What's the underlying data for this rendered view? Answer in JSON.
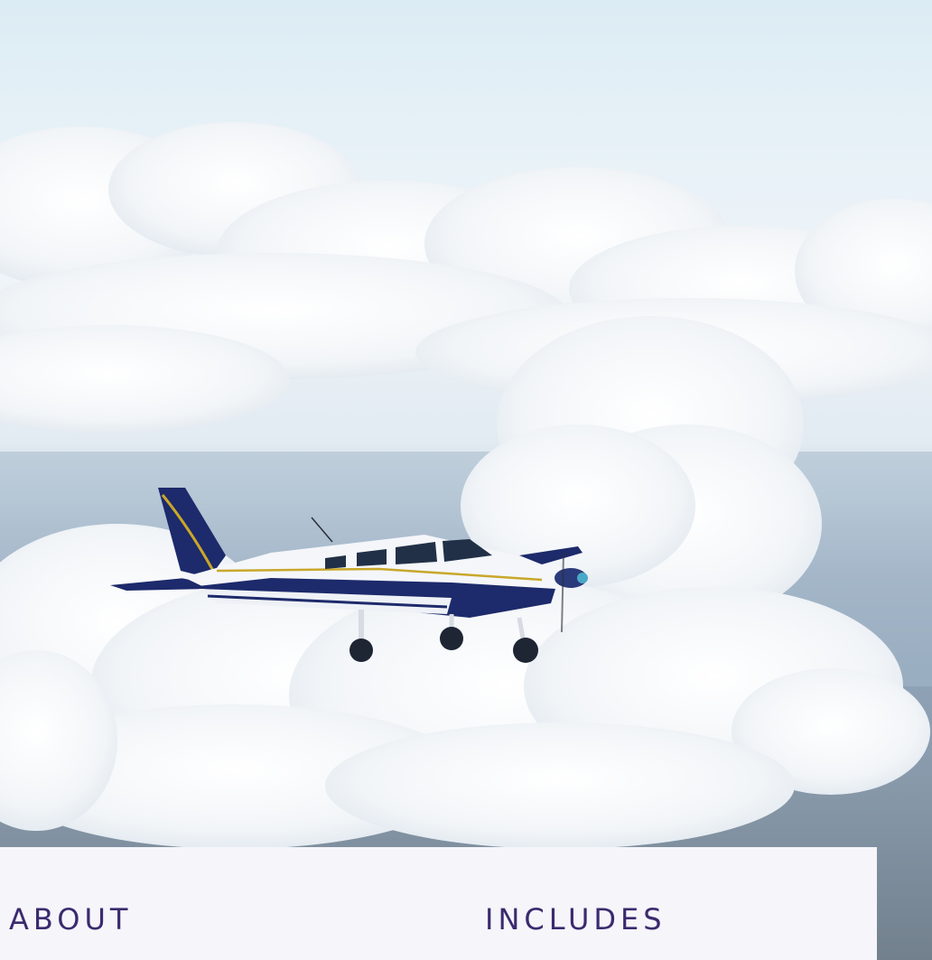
{
  "hero": {
    "image": "airplane-over-clouds-photo"
  },
  "sections": {
    "about_label": "ABOUT",
    "includes_label": "INCLUDES"
  },
  "colors": {
    "heading": "#3b2a6e",
    "card_background": "#f5f5fa",
    "aircraft_blue": "#1d2a6b",
    "aircraft_stripe": "#c9a72a"
  }
}
